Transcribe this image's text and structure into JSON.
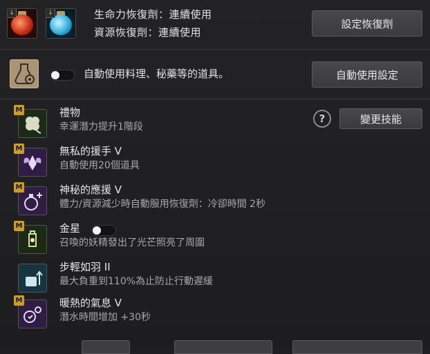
{
  "potions": {
    "hp_label": "生命力恢復劑：連續使用",
    "resource_label": "資源恢復劑：連續使用",
    "settings_button": "設定恢復劑",
    "hp_icon": "red-potion-icon",
    "resource_icon": "blue-potion-icon"
  },
  "auto_use": {
    "label": "自動使用料理、秘藥等的道具。",
    "toggle_on": false,
    "settings_button": "自動使用設定",
    "icon": "flask-gear-icon"
  },
  "help_label": "?",
  "change_skill_button": "變更技能",
  "skills": [
    {
      "badge": "M",
      "name": "禮物",
      "desc": "幸運潛力提升1階段",
      "icon": "clover-icon",
      "color": "#2a3a22"
    },
    {
      "badge": "M",
      "name": "無私的援手 V",
      "desc": "自動使用20個道具",
      "icon": "fairy-icon",
      "color": "#3a2450"
    },
    {
      "badge": "M",
      "name": "神秘的應援 V",
      "desc": "體力/資源減少時自動服用恢復劑：冷卻時間 2秒",
      "icon": "potion-plus-icon",
      "color": "#3a2450"
    },
    {
      "badge": "M",
      "name": "金星",
      "desc": "召喚的妖精發出了光芒照亮了周圍",
      "icon": "lantern-icon",
      "color": "#2a3a22",
      "toggle_on": false
    },
    {
      "badge": "",
      "name": "步輕如羽 II",
      "desc": "最大負重到110%為止防止行動遲緩",
      "icon": "weight-icon",
      "color": "#1e3a44"
    },
    {
      "badge": "M",
      "name": "暖熱的氣息 V",
      "desc": "潛水時間增加 +30秒",
      "icon": "bubble-icon",
      "color": "#3a2450"
    }
  ],
  "colors": {
    "background": "#1f1f21",
    "button": "#434347",
    "badge": "#c79a3a"
  }
}
